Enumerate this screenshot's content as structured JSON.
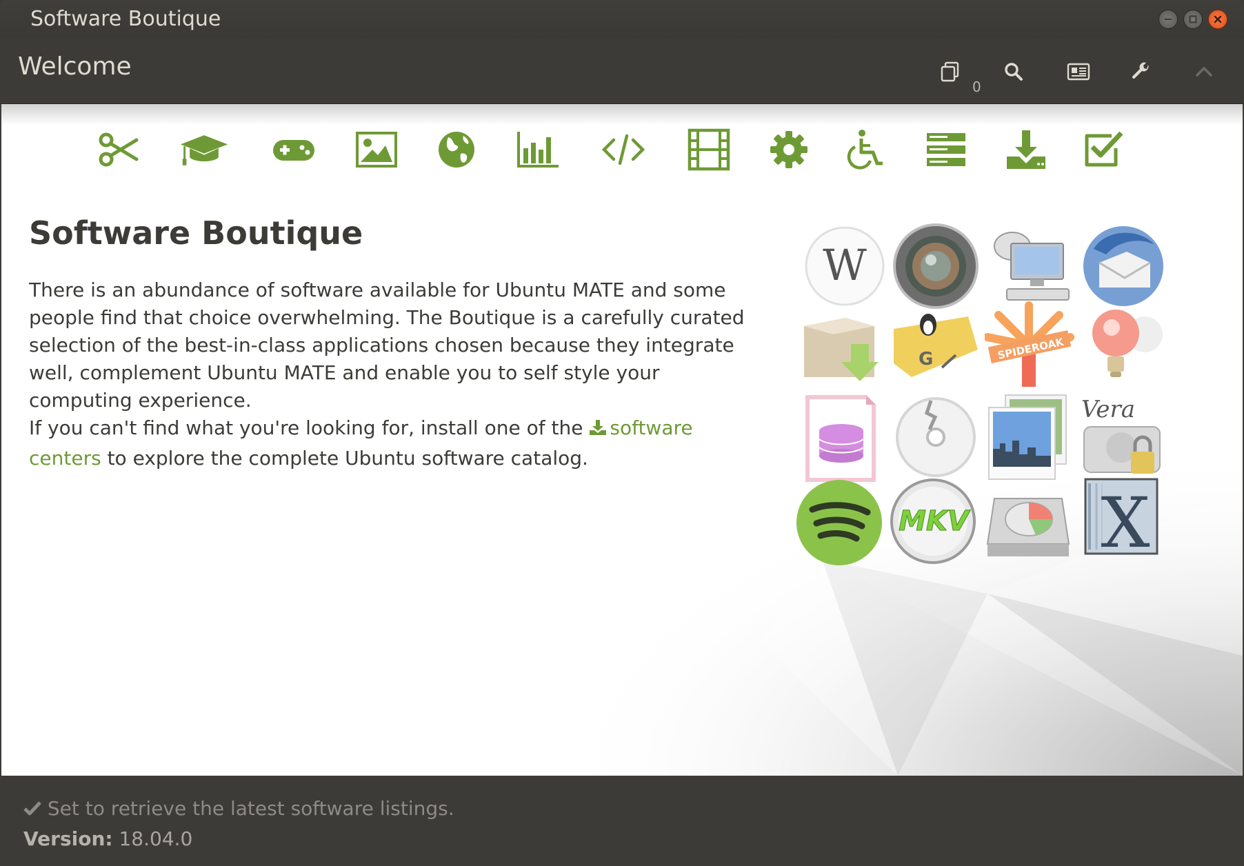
{
  "window": {
    "title": "Software Boutique"
  },
  "header": {
    "title": "Welcome",
    "queue_count": "0",
    "buttons": [
      "queue-icon",
      "search-icon",
      "news-icon",
      "preferences-icon",
      "collapse-icon"
    ]
  },
  "categories": [
    {
      "name": "accessories",
      "icon": "scissors-icon"
    },
    {
      "name": "education",
      "icon": "graduation-cap-icon"
    },
    {
      "name": "games",
      "icon": "gamepad-icon"
    },
    {
      "name": "graphics",
      "icon": "picture-icon"
    },
    {
      "name": "internet",
      "icon": "globe-icon"
    },
    {
      "name": "office",
      "icon": "bar-chart-icon"
    },
    {
      "name": "programming",
      "icon": "code-icon"
    },
    {
      "name": "sound-video",
      "icon": "film-icon"
    },
    {
      "name": "system-tools",
      "icon": "gear-icon"
    },
    {
      "name": "universal-access",
      "icon": "wheelchair-icon"
    },
    {
      "name": "servers",
      "icon": "server-icon"
    },
    {
      "name": "installed",
      "icon": "download-icon"
    },
    {
      "name": "selection",
      "icon": "checkbox-icon"
    }
  ],
  "main": {
    "heading": "Software Boutique",
    "intro": "There is an abundance of software available for Ubuntu MATE and some people find that choice overwhelming. The Boutique is a carefully curated selection of the best-in-class applications chosen because they integrate well, complement Ubuntu MATE and enable you to self style your computing experience.",
    "more_before": "If you can't find what you're looking for, install one of the ",
    "more_link": "software centers",
    "more_after": " to explore the complete Ubuntu software catalog."
  },
  "app_icons": [
    {
      "name": "writer-app-icon",
      "label": "W"
    },
    {
      "name": "camera-app-icon"
    },
    {
      "name": "remote-desktop-app-icon"
    },
    {
      "name": "thunderbird-app-icon"
    },
    {
      "name": "package-installer-app-icon"
    },
    {
      "name": "tux-plane-app-icon",
      "label": "G"
    },
    {
      "name": "spideroak-app-icon",
      "label": "SPIDEROAK"
    },
    {
      "name": "idea-bulb-app-icon"
    },
    {
      "name": "libreoffice-base-app-icon"
    },
    {
      "name": "brasero-disc-app-icon"
    },
    {
      "name": "photo-viewer-app-icon"
    },
    {
      "name": "veracrypt-app-icon",
      "label": "Vera"
    },
    {
      "name": "spotify-app-icon"
    },
    {
      "name": "mkvtoolnix-app-icon",
      "label": "MKV"
    },
    {
      "name": "disk-usage-app-icon"
    },
    {
      "name": "x-app-icon",
      "label": "X"
    }
  ],
  "status": {
    "message": "Set to retrieve the latest software listings.",
    "version_label": "Version:",
    "version_value": "18.04.0"
  },
  "colors": {
    "accent": "#6e9a35",
    "chrome": "#3c3b37",
    "close": "#e1521d"
  }
}
